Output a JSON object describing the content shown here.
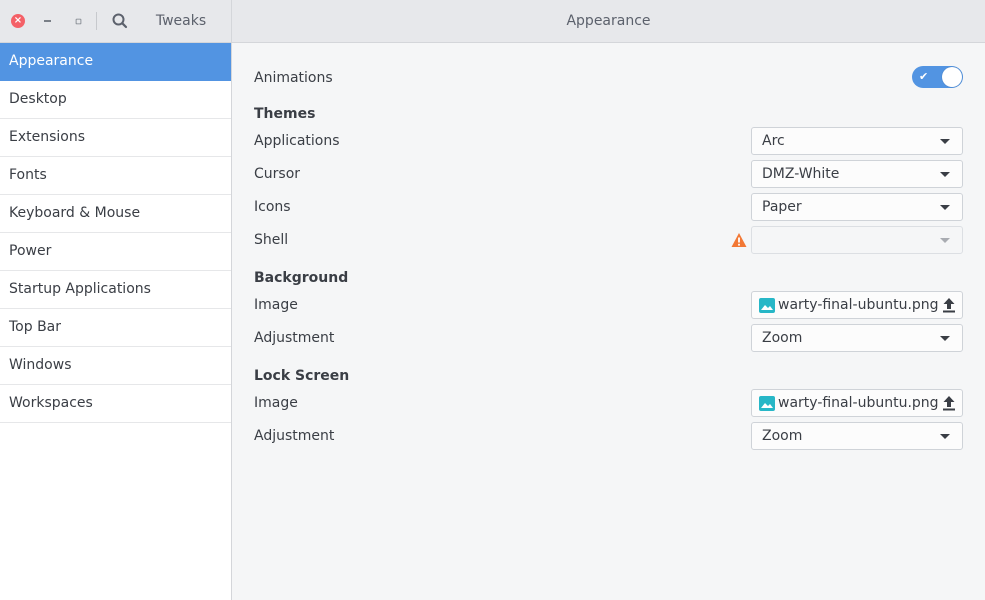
{
  "app": {
    "title": "Tweaks",
    "page_title": "Appearance"
  },
  "colors": {
    "accent": "#5294e2",
    "close": "#f46067",
    "warning": "#f27835",
    "image_icon": "#27b7c7"
  },
  "icons": {
    "close": "close-icon",
    "minimize": "minimize-icon",
    "maximize": "maximize-icon",
    "search": "search-icon",
    "warning": "warning-icon",
    "image": "image-file-icon",
    "upload": "upload-icon"
  },
  "sidebar": {
    "items": [
      {
        "label": "Appearance",
        "active": true
      },
      {
        "label": "Desktop"
      },
      {
        "label": "Extensions"
      },
      {
        "label": "Fonts"
      },
      {
        "label": "Keyboard & Mouse"
      },
      {
        "label": "Power"
      },
      {
        "label": "Startup Applications"
      },
      {
        "label": "Top Bar"
      },
      {
        "label": "Windows"
      },
      {
        "label": "Workspaces"
      }
    ]
  },
  "appearance": {
    "animations": {
      "label": "Animations",
      "enabled": true
    },
    "themes": {
      "heading": "Themes",
      "applications": {
        "label": "Applications",
        "value": "Arc"
      },
      "cursor": {
        "label": "Cursor",
        "value": "DMZ-White"
      },
      "icons": {
        "label": "Icons",
        "value": "Paper"
      },
      "shell": {
        "label": "Shell",
        "value": "",
        "disabled": true,
        "warning": true
      }
    },
    "background": {
      "heading": "Background",
      "image": {
        "label": "Image",
        "value": "warty-final-ubuntu.png"
      },
      "adjustment": {
        "label": "Adjustment",
        "value": "Zoom"
      }
    },
    "lock_screen": {
      "heading": "Lock Screen",
      "image": {
        "label": "Image",
        "value": "warty-final-ubuntu.png"
      },
      "adjustment": {
        "label": "Adjustment",
        "value": "Zoom"
      }
    }
  }
}
